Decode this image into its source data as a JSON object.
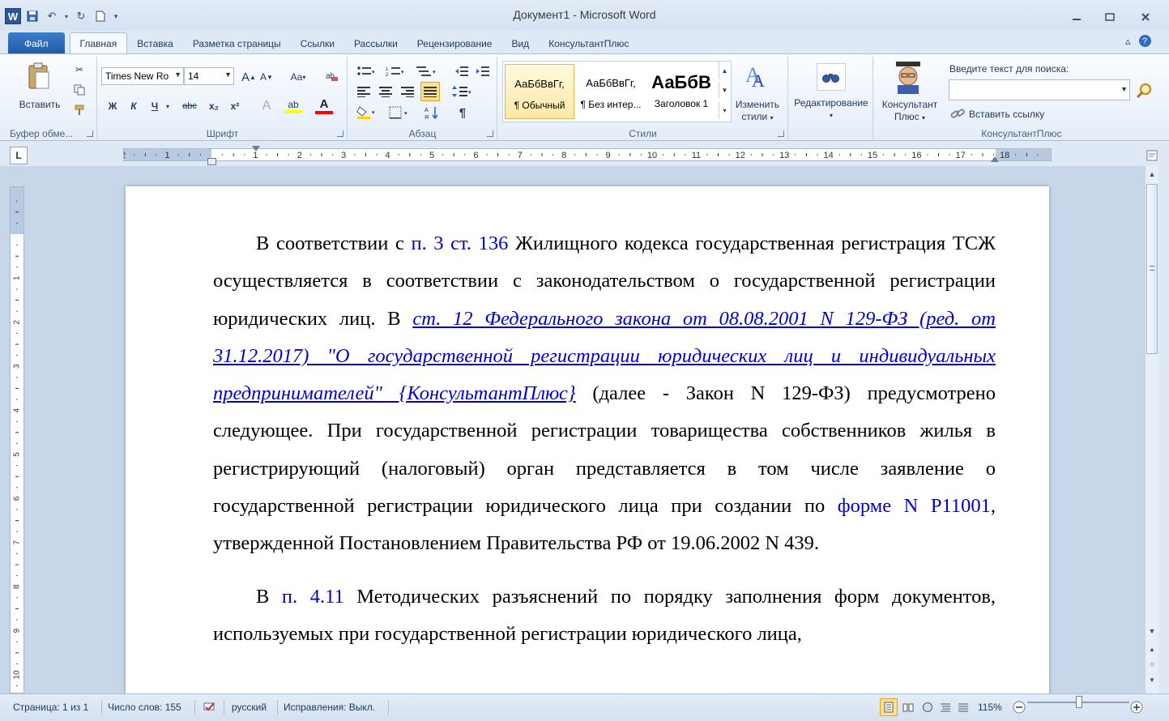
{
  "window": {
    "title": "Документ1  -  Microsoft Word",
    "app_icon": "W",
    "controls": [
      "minimize-icon",
      "restore-icon",
      "close-icon"
    ]
  },
  "qat": [
    "save-icon",
    "undo-icon",
    "redo-icon",
    "new-doc-icon",
    "customize-qat-icon"
  ],
  "tabs": [
    {
      "label": "Файл"
    },
    {
      "label": "Главная"
    },
    {
      "label": "Вставка"
    },
    {
      "label": "Разметка страницы"
    },
    {
      "label": "Ссылки"
    },
    {
      "label": "Рассылки"
    },
    {
      "label": "Рецензирование"
    },
    {
      "label": "Вид"
    },
    {
      "label": "КонсультантПлюс"
    }
  ],
  "ribbon": {
    "clipboard": {
      "label": "Буфер обме...",
      "paste_label": "Вставить"
    },
    "font": {
      "label": "Шрифт",
      "font_name": "Times New Ro",
      "font_size": "14",
      "grow": "A",
      "shrink": "A",
      "case": "Aa",
      "bold": "Ж",
      "italic": "К",
      "underline": "Ч",
      "strike": "abc",
      "subscript": "x₂",
      "superscript": "x²",
      "font_color_letter": "A",
      "highlight_letter": "ab"
    },
    "paragraph": {
      "label": "Абзац",
      "pilcrow": "¶"
    },
    "styles": {
      "label": "Стили",
      "items": [
        {
          "preview": "АаБбВвГг,",
          "name": "¶ Обычный"
        },
        {
          "preview": "АаБбВвГг,",
          "name": "¶ Без интер..."
        },
        {
          "preview": "АаБбВ",
          "name": "Заголовок 1"
        }
      ],
      "change_styles_line1": "Изменить",
      "change_styles_line2": "стили"
    },
    "editing": {
      "label": "Редактирование"
    },
    "consultant": {
      "button_line1": "Консультант",
      "button_line2": "Плюс",
      "search_label": "Введите текст для поиска:",
      "search_value": "",
      "insert_link": "Вставить ссылку",
      "group_label": "КонсультантПлюс"
    }
  },
  "rulers": {
    "tab_selector": "L",
    "h_numbers": [
      "2",
      "1",
      "1",
      "2",
      "3",
      "4",
      "5",
      "6",
      "7",
      "8",
      "9",
      "10",
      "11",
      "12",
      "13",
      "14",
      "15",
      "16",
      "17",
      "18"
    ],
    "v_numbers": [
      "1",
      "1",
      "2",
      "3",
      "4",
      "5",
      "6",
      "7",
      "8",
      "9",
      "10"
    ]
  },
  "document": {
    "p1": {
      "t1": "В соответствии с ",
      "l1": "п. 3 ст. 136",
      "t2": " Жилищного кодекса государственная регистрация ТСЖ осуществляется в соответствии с законодательством о государственной регистрации юридических лиц. В ",
      "l2": "ст. 12 Федерального закона от 08.08.2001 N 129-ФЗ (ред. от 31.12.2017) \"О государственной регистрации юридических лиц и индивидуальных предпринимателей\" {КонсультантПлюс}",
      "t3": " (далее - Закон N 129-ФЗ) предусмотрено следующее. При государственной регистрации товарищества собственников жилья в регистрирующий (налоговый) орган представляется в том числе заявление о государственной регистрации юридического лица при создании по ",
      "l3": "форме N Р11001",
      "t4": ", утвержденной Постановлением Правительства РФ от 19.06.2002 N 439."
    },
    "p2": {
      "t1": "В ",
      "l1": "п. 4.11",
      "t2": " Методических разъяснений по порядку заполнения форм документов, используемых при государственной регистрации юридического лица,"
    }
  },
  "status": {
    "page": "Страница: 1 из 1",
    "words": "Число слов: 155",
    "language": "русский",
    "track_changes": "Исправления: Выкл.",
    "zoom": "115%",
    "zoom_level_percent": 115
  },
  "colors": {
    "link": "#0000d8",
    "file_tab": "#2b62ad",
    "ribbon_bg": "#e4edf8"
  }
}
